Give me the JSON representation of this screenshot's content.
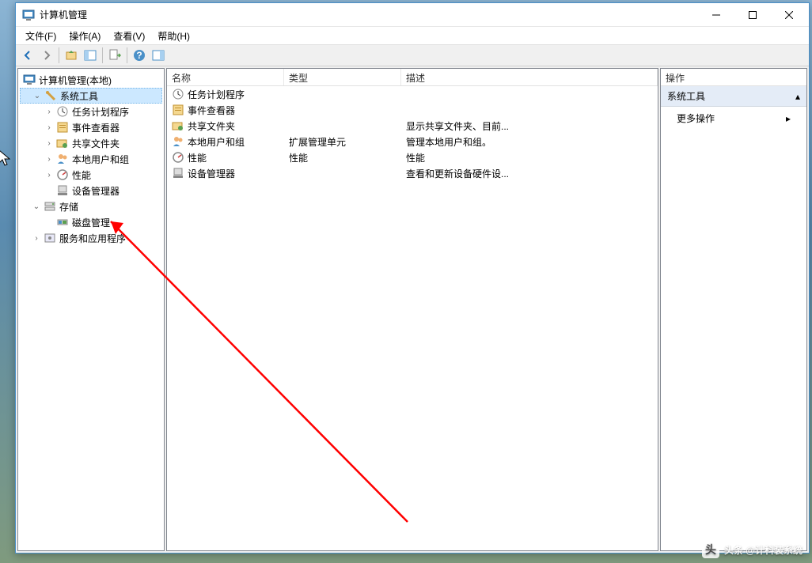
{
  "window": {
    "title": "计算机管理"
  },
  "menubar": [
    "文件(F)",
    "操作(A)",
    "查看(V)",
    "帮助(H)"
  ],
  "tree": {
    "root": "计算机管理(本地)",
    "system_tools": "系统工具",
    "task_scheduler": "任务计划程序",
    "event_viewer": "事件查看器",
    "shared_folders": "共享文件夹",
    "local_users": "本地用户和组",
    "performance": "性能",
    "device_manager": "设备管理器",
    "storage": "存储",
    "disk_management": "磁盘管理",
    "services_apps": "服务和应用程序"
  },
  "list": {
    "headers": {
      "name": "名称",
      "type": "类型",
      "desc": "描述"
    },
    "rows": [
      {
        "name": "任务计划程序",
        "type": "",
        "desc": ""
      },
      {
        "name": "事件查看器",
        "type": "",
        "desc": ""
      },
      {
        "name": "共享文件夹",
        "type": "",
        "desc": "显示共享文件夹、目前..."
      },
      {
        "name": "本地用户和组",
        "type": "扩展管理单元",
        "desc": "管理本地用户和组。"
      },
      {
        "name": "性能",
        "type": "性能",
        "desc": "性能"
      },
      {
        "name": "设备管理器",
        "type": "",
        "desc": "查看和更新设备硬件设..."
      }
    ]
  },
  "actions": {
    "header": "操作",
    "section": "系统工具",
    "more": "更多操作"
  },
  "watermark": "头条 @计科装系统"
}
